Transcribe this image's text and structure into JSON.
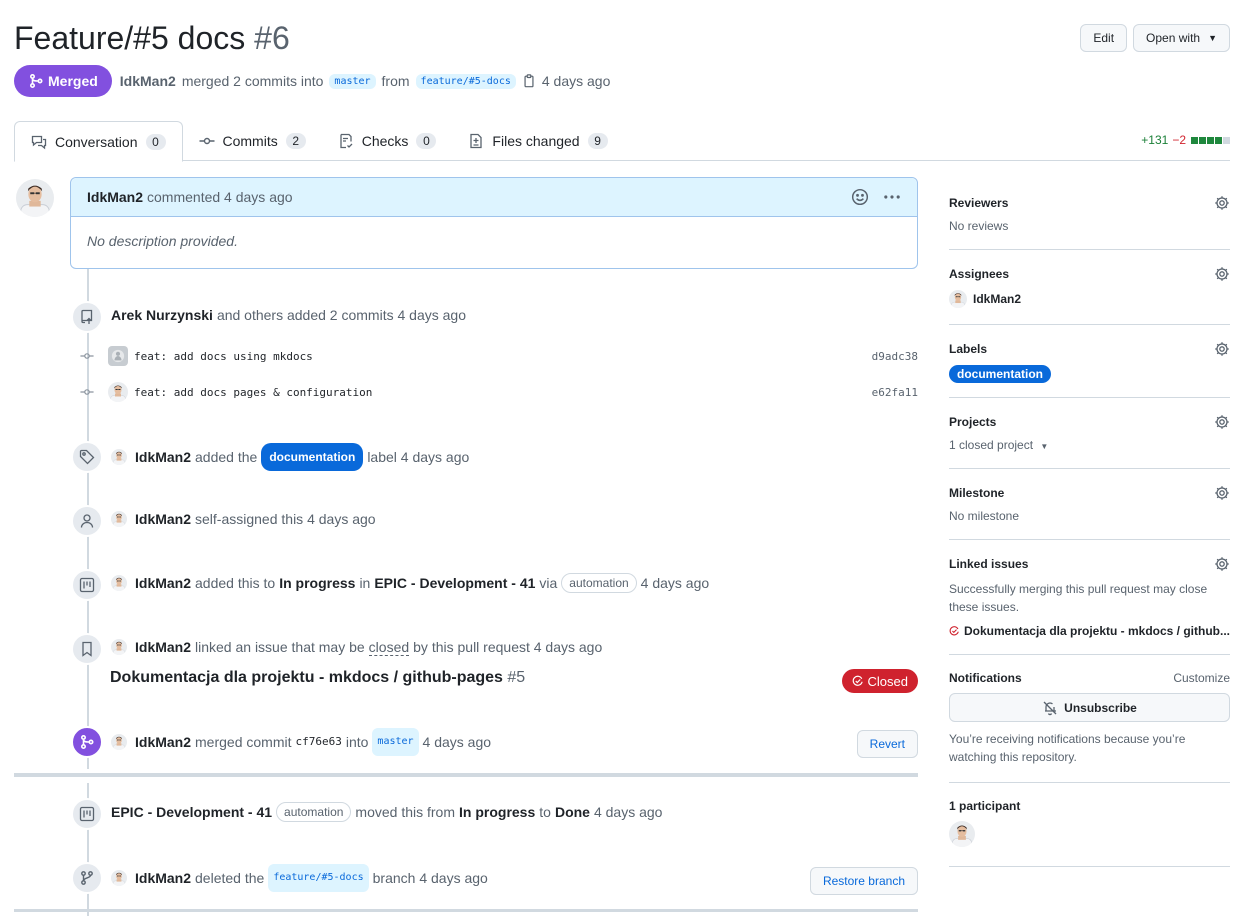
{
  "header": {
    "title": "Feature/#5 docs",
    "number": "#6",
    "edit_label": "Edit",
    "open_with_label": "Open with"
  },
  "meta": {
    "state": "Merged",
    "author": "IdkMan2",
    "action": "merged 2 commits into",
    "base_branch": "master",
    "from": "from",
    "head_branch": "feature/#5-docs",
    "time": "4 days ago"
  },
  "tabs": [
    {
      "label": "Conversation",
      "count": "0"
    },
    {
      "label": "Commits",
      "count": "2"
    },
    {
      "label": "Checks",
      "count": "0"
    },
    {
      "label": "Files changed",
      "count": "9"
    }
  ],
  "diffstat": {
    "additions": "+131",
    "deletions": "−2"
  },
  "comment": {
    "author": "IdkMan2",
    "action": "commented 4 days ago",
    "body": "No description provided."
  },
  "timeline": {
    "commits_event": {
      "author": "Arek Nurzynski",
      "text": "and others added 2 commits 4 days ago"
    },
    "commits": [
      {
        "message": "feat: add docs using mkdocs",
        "sha": "d9adc38"
      },
      {
        "message": "feat: add docs pages & configuration",
        "sha": "e62fa11"
      }
    ],
    "label_event": {
      "author": "IdkMan2",
      "pre": "added the",
      "label": "documentation",
      "post": "label 4 days ago"
    },
    "assign_event": {
      "author": "IdkMan2",
      "text": "self-assigned this 4 days ago"
    },
    "project_event": {
      "author": "IdkMan2",
      "pre": "added this to",
      "column": "In progress",
      "in": "in",
      "project": "EPIC - Development - 41",
      "via": "via",
      "bot": "automation",
      "time": "4 days ago"
    },
    "link_event": {
      "author": "IdkMan2",
      "pre": "linked an issue that may be",
      "closed_word": "closed",
      "post": "by this pull request 4 days ago",
      "issue_title": "Dokumentacja dla projektu - mkdocs / github-pages",
      "issue_number": "#5",
      "issue_state": "Closed"
    },
    "merge_event": {
      "author": "IdkMan2",
      "pre": "merged commit",
      "sha": "cf76e63",
      "into": "into",
      "branch": "master",
      "time": "4 days ago",
      "button": "Revert"
    },
    "move_event": {
      "project": "EPIC - Development - 41",
      "bot": "automation",
      "pre": "moved this from",
      "from": "In progress",
      "to_word": "to",
      "to": "Done",
      "time": "4 days ago"
    },
    "delete_event": {
      "author": "IdkMan2",
      "pre": "deleted the",
      "branch": "feature/#5-docs",
      "post": "branch 4 days ago",
      "button": "Restore branch"
    }
  },
  "sidebar": {
    "reviewers": {
      "title": "Reviewers",
      "value": "No reviews"
    },
    "assignees": {
      "title": "Assignees",
      "value": "IdkMan2"
    },
    "labels": {
      "title": "Labels",
      "value": "documentation"
    },
    "projects": {
      "title": "Projects",
      "value": "1 closed project"
    },
    "milestone": {
      "title": "Milestone",
      "value": "No milestone"
    },
    "linked_issues": {
      "title": "Linked issues",
      "note": "Successfully merging this pull request may close these issues.",
      "issue": "Dokumentacja dla projektu - mkdocs / github..."
    },
    "notifications": {
      "title": "Notifications",
      "customize": "Customize",
      "button": "Unsubscribe",
      "note": "You’re receiving notifications because you’re watching this repository."
    },
    "participants": {
      "title": "1 participant"
    }
  },
  "colors": {
    "merged": "#8250df",
    "closed": "#cf222e",
    "label": "#0969da",
    "additions": "#1a7f37",
    "deletions": "#d1242f"
  },
  "icons": [
    "git-merge-icon",
    "copy-icon",
    "comment-discussion-icon",
    "git-commit-icon",
    "checklist-icon",
    "file-diff-icon",
    "smiley-icon",
    "kebab-horizontal-icon",
    "repo-push-icon",
    "tag-icon",
    "person-icon",
    "project-icon",
    "bookmark-icon",
    "issue-closed-icon",
    "git-branch-icon",
    "gear-icon",
    "bell-slash-icon",
    "triangle-down-icon"
  ]
}
